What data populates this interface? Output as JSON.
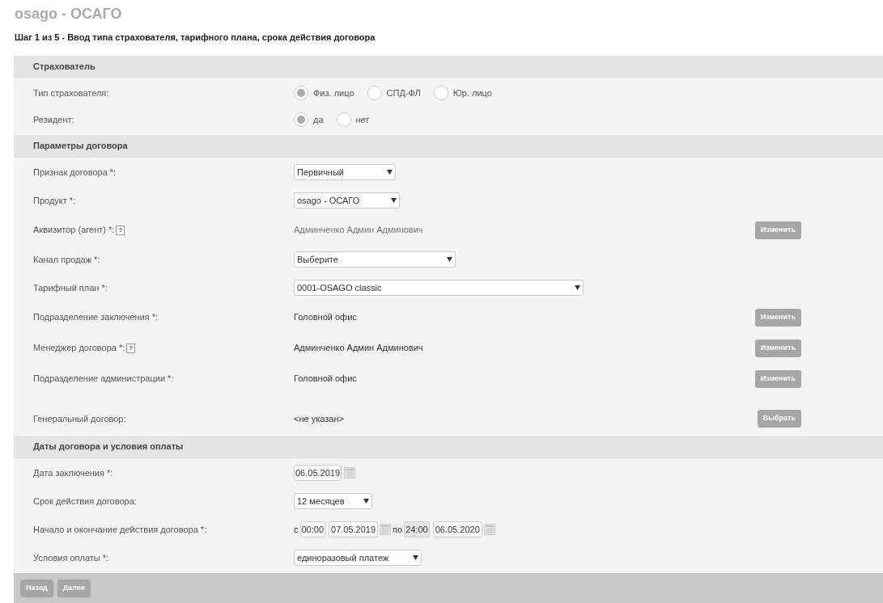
{
  "title": "osago - ОСАГО",
  "step": "Шаг 1 из 5 - Ввод типа страхователя, тарифного плана, срока действия договора",
  "sections": [
    {
      "title": "Страхователь",
      "rows": [
        {
          "kind": "radio",
          "label": "Тип страхователя:",
          "options": [
            {
              "label": "Физ. лицо",
              "selected": true
            },
            {
              "label": "СПД-ФЛ",
              "selected": false
            },
            {
              "label": "Юр. лицо",
              "selected": false
            }
          ]
        },
        {
          "kind": "radio",
          "label": "Резидент:",
          "options": [
            {
              "label": "да",
              "selected": true
            },
            {
              "label": "нет",
              "selected": false
            }
          ]
        }
      ]
    },
    {
      "title": "Параметры договора",
      "rows": [
        {
          "kind": "select",
          "label": "Признак договора *:",
          "value": "Первичный"
        },
        {
          "kind": "select",
          "label": "Продукт *:",
          "value": "osago - ОСАГО"
        },
        {
          "kind": "text",
          "label": "Аквизитор (агент) *:",
          "help": "?",
          "value": "Админченко Админ Админович",
          "muted": true,
          "button": "Изменить"
        },
        {
          "kind": "select",
          "label": "Канал продаж *:",
          "value": "Выберите"
        },
        {
          "kind": "select",
          "label": "Тарифный план *:",
          "value": "0001-OSAGO classic"
        },
        {
          "kind": "text",
          "label": "Подразделение заключения *:",
          "value": "Головной офис",
          "muted": false,
          "button": "Изменить"
        },
        {
          "kind": "text",
          "label": "Менеджер договора *:",
          "help": "?",
          "value": "Админченко Админ Админович",
          "muted": false,
          "button": "Изменить"
        },
        {
          "kind": "text",
          "label": "Подразделение администрации *:",
          "value": "Головной офис",
          "muted": false,
          "button": "Изменить"
        },
        {
          "kind": "text",
          "label": "Генеральный договор:",
          "value": "<не указан>",
          "muted": false,
          "button": "Выбрать"
        }
      ]
    },
    {
      "title": "Даты договора и условия оплаты",
      "rows": [
        {
          "kind": "date",
          "label": "Дата заключения *:",
          "value": "06.05.2019"
        },
        {
          "kind": "select",
          "label": "Срок действия договора:",
          "value": "12 месяцев"
        },
        {
          "kind": "period",
          "label": "Начало и окончание действия договора *:",
          "from_word": "с",
          "from_time": "00:00",
          "from_time_disabled": false,
          "from_date": "07.05.2019",
          "to_word": "по",
          "to_time": "24:00",
          "to_time_disabled": true,
          "to_date": "06.05.2020"
        },
        {
          "kind": "select",
          "label": "Условия оплаты *:",
          "value": "единоразовый платеж"
        }
      ]
    }
  ],
  "buttons": [
    "Назад",
    "Далее"
  ]
}
